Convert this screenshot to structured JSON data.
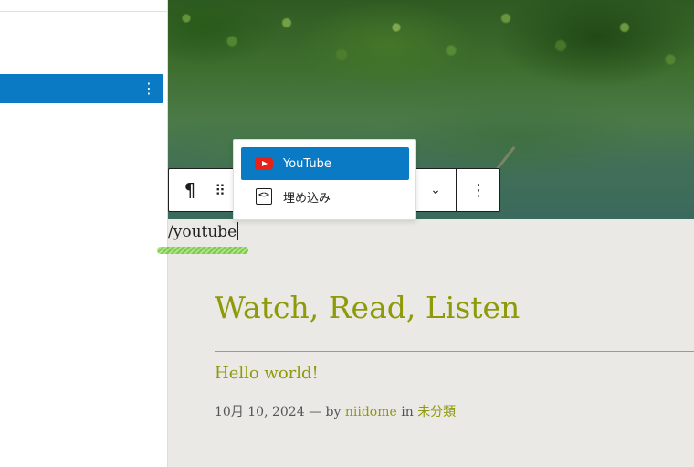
{
  "toolbar": {
    "paragraph_icon": "¶",
    "drag_icon": "⠿",
    "chevron_icon": "⌄",
    "more_icon": "⋮"
  },
  "sidebar": {
    "selected_row_menu_icon": "⋮"
  },
  "inserter": {
    "items": [
      {
        "label": "YouTube",
        "icon": "youtube-icon",
        "active": true
      },
      {
        "label": "埋め込み",
        "icon": "embed-icon",
        "active": false
      }
    ],
    "embed_icon_glyph": "<>"
  },
  "editor": {
    "slash_text": "/youtube"
  },
  "page": {
    "title": "Watch, Read, Listen",
    "post_title": "Hello world!",
    "post_date": "10月 10, 2024",
    "separator": "—",
    "by_label": "by",
    "author": "niidome",
    "in_label": "in",
    "category": "未分類"
  },
  "colors": {
    "accent": "#0a7ac4",
    "link": "#8e9a0a",
    "youtube_red": "#e62117",
    "page_background": "#ebe9e6"
  }
}
